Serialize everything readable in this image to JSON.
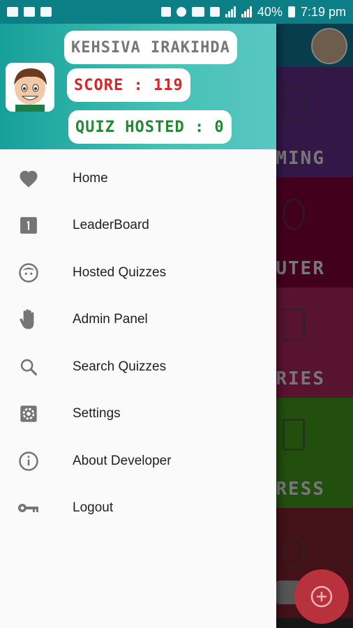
{
  "status_bar": {
    "battery": "40%",
    "time": "7:19 pm"
  },
  "app": {
    "tiles": [
      {
        "label": "MMING",
        "color": "#5b2a82"
      },
      {
        "label": "UTER",
        "color": "#7a0035"
      },
      {
        "label": "ERIES",
        "color": "#a12358"
      },
      {
        "label": "CTRESS",
        "color": "#3f8f1a"
      },
      {
        "label": "",
        "color": "#7a1f2c"
      }
    ]
  },
  "drawer": {
    "header": {
      "name": "KEHSIVA IRAKIHDA",
      "score": "SCORE : 119",
      "quiz_hosted": "QUIZ HOSTED : 0"
    },
    "menu": [
      {
        "label": "Home",
        "icon": "heart-icon"
      },
      {
        "label": "LeaderBoard",
        "icon": "leaderboard-icon"
      },
      {
        "label": "Hosted Quizzes",
        "icon": "face-icon"
      },
      {
        "label": "Admin Panel",
        "icon": "hand-icon"
      },
      {
        "label": "Search Quizzes",
        "icon": "search-icon"
      },
      {
        "label": "Settings",
        "icon": "gear-icon"
      },
      {
        "label": "About Developer",
        "icon": "info-icon"
      },
      {
        "label": "Logout",
        "icon": "key-icon"
      }
    ]
  }
}
